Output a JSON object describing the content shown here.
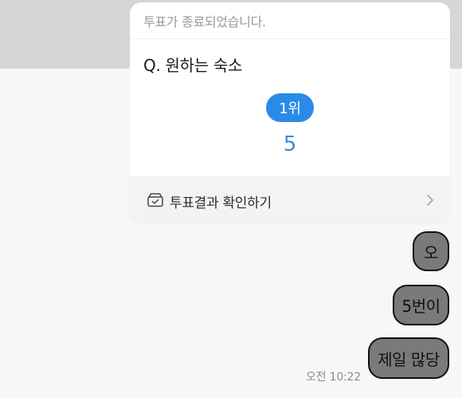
{
  "poll": {
    "status_text": "투표가 종료되었습니다.",
    "question": "Q. 원하는 숙소",
    "rank_label": "1위",
    "vote_count": "5",
    "result_button_label": "투표결과 확인하기",
    "accent_color": "#2a8ae6"
  },
  "icons": {
    "result": "ballot-box-check-icon",
    "chevron": "chevron-right-icon"
  },
  "messages": [
    {
      "text": "오"
    },
    {
      "text": "5번이"
    },
    {
      "text": "제일 많당"
    }
  ],
  "timestamp": "오전 10:22",
  "colors": {
    "top_band": "#d6d6d6",
    "chat_background": "#f7f7f7",
    "bubble_fill": "#7a7a7a",
    "bubble_border": "#111111"
  }
}
